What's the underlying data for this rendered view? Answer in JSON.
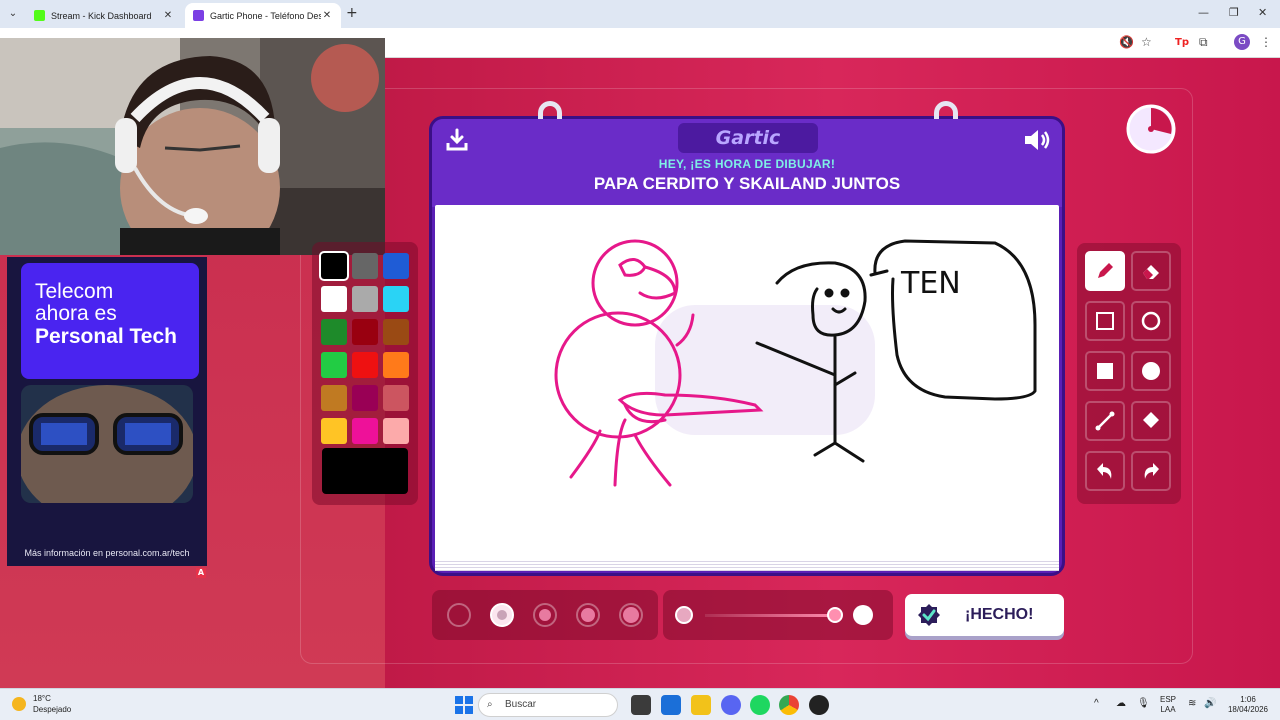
{
  "browser": {
    "tabs": [
      {
        "title": "Stream - Kick Dashboard",
        "favicon_color": "#53fc18"
      },
      {
        "title": "Gartic Phone - Teléfono Descomp",
        "favicon_color": "#7b3fe4"
      }
    ],
    "new_tab": "+",
    "window_controls": [
      "—",
      "❐",
      "✕"
    ],
    "profile_initial": "G"
  },
  "game": {
    "logo": "Gartic",
    "prompt_sub": "HEY, ¡ES HORA DE DIBUJAR!",
    "prompt_main": "PAPA CERDITO Y SKAILAND JUNTOS",
    "canvas_text": "TEN",
    "done_label": "¡HECHO!",
    "selected_color": "#000000",
    "selected_tool": "pencil",
    "selected_size_index": 1,
    "palette": [
      [
        "#000000",
        "#666666",
        "#1f5cd6"
      ],
      [
        "#ffffff",
        "#aaaaaa",
        "#2ad3f5"
      ],
      [
        "#1e8a2a",
        "#990010",
        "#9a4a14"
      ],
      [
        "#22cc44",
        "#ee1111",
        "#ff7a1a"
      ],
      [
        "#c07a22",
        "#990055",
        "#cc5560"
      ],
      [
        "#ffc425",
        "#ee1199",
        "#fcaaaa"
      ]
    ],
    "tools": [
      "pencil-icon",
      "eraser-icon",
      "rectangle-outline-icon",
      "ellipse-outline-icon",
      "rectangle-filled-icon",
      "ellipse-filled-icon",
      "line-icon",
      "fill-bucket-icon",
      "undo-icon",
      "redo-icon"
    ]
  },
  "ad": {
    "line1": "Telecom",
    "line2": "ahora es",
    "line3": "Personal Tech",
    "footer": "Más información en personal.com.ar/tech",
    "badge": "A"
  },
  "taskbar": {
    "temperature": "18°C",
    "weather": "Despejado",
    "search_placeholder": "Buscar",
    "lang_line1": "ESP",
    "lang_line2": "LAA",
    "time": "1:06",
    "date": "18/04/2026"
  }
}
